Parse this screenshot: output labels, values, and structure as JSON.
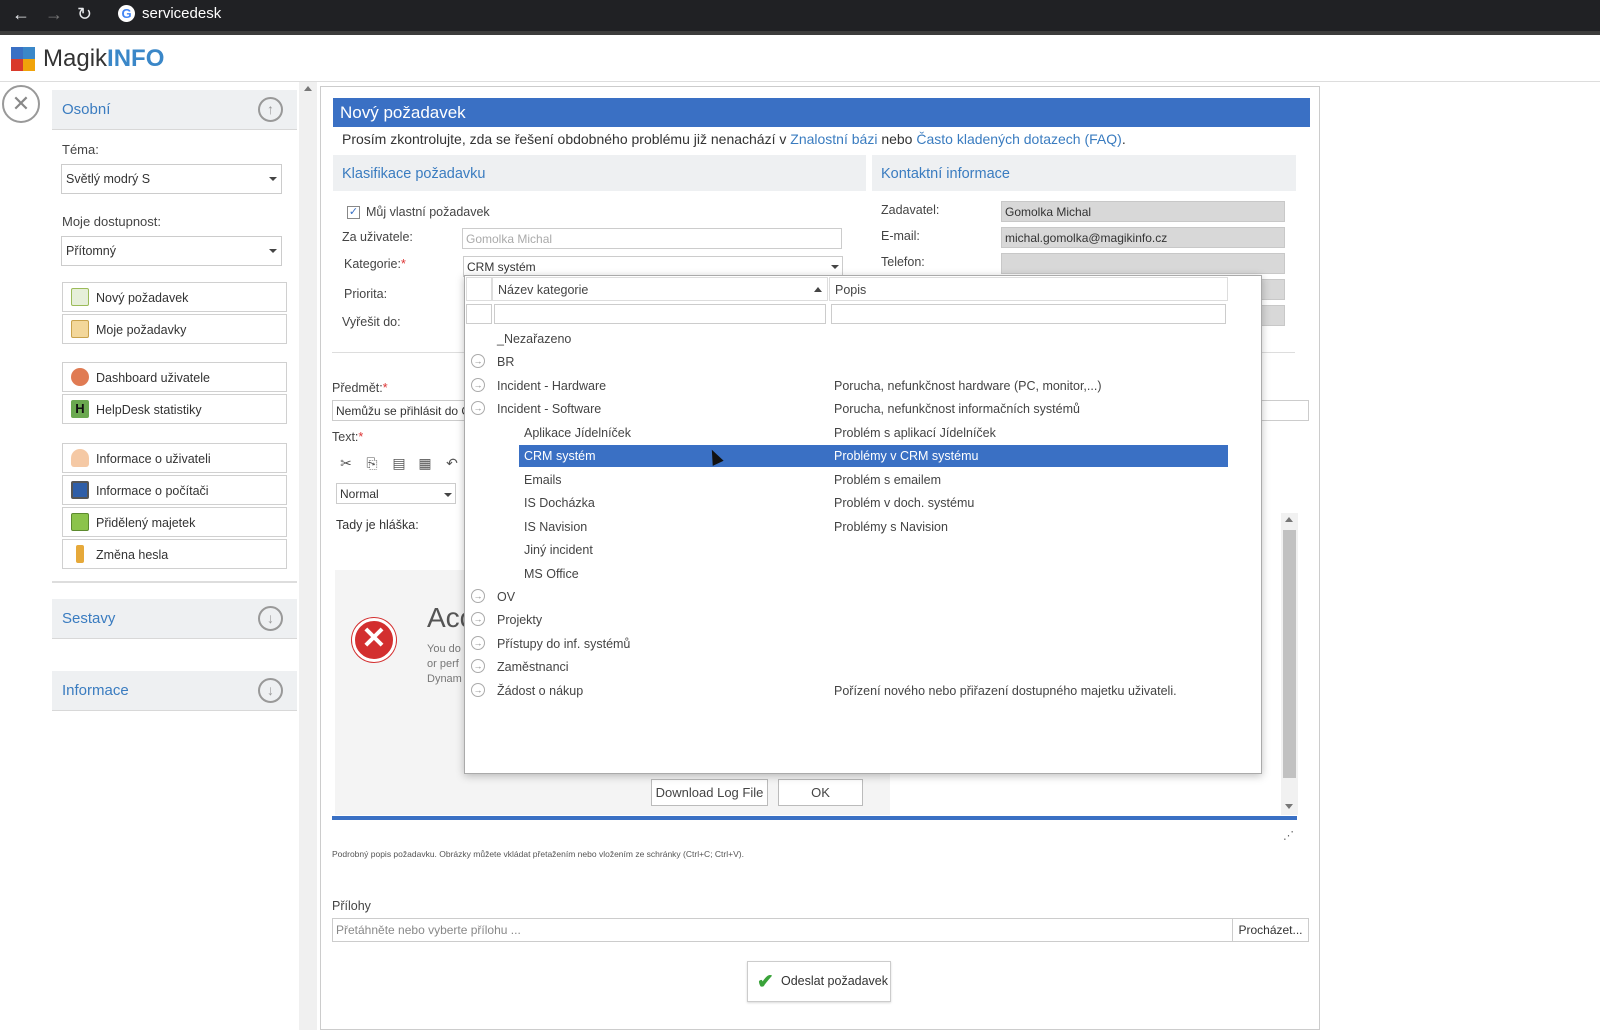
{
  "browser": {
    "url": "servicedesk"
  },
  "logo": {
    "part1": "Magik",
    "part2": "INFO"
  },
  "sidebar": {
    "section_personal": "Osobní",
    "theme_label": "Téma:",
    "theme_value": "Světlý modrý S",
    "availability_label": "Moje dostupnost:",
    "availability_value": "Přítomný",
    "buttons": [
      {
        "label": "Nový požadavek"
      },
      {
        "label": "Moje požadavky"
      },
      {
        "label": "Dashboard uživatele"
      },
      {
        "label": "HelpDesk statistiky"
      },
      {
        "label": "Informace o uživateli"
      },
      {
        "label": "Informace o počítači"
      },
      {
        "label": "Přidělený majetek"
      },
      {
        "label": "Změna hesla"
      }
    ],
    "section_reports": "Sestavy",
    "section_info": "Informace"
  },
  "form": {
    "title": "Nový požadavek",
    "notice_pre": "Prosím zkontrolujte, zda se řešení obdobného problému již nenachází v ",
    "notice_link1": "Znalostní bázi",
    "notice_mid": " nebo ",
    "notice_link2": "Často kladených dotazech (FAQ)",
    "notice_end": ".",
    "classification_header": "Klasifikace požadavku",
    "contact_header": "Kontaktní informace",
    "own_request_label": "Můj vlastní požadavek",
    "for_user_label": "Za uživatele:",
    "for_user_value": "Gomolka Michal",
    "category_label": "Kategorie:",
    "category_value": "CRM systém",
    "priority_label": "Priorita:",
    "resolve_by_label": "Vyřešit do:",
    "requester_label": "Zadavatel:",
    "requester_value": "Gomolka Michal",
    "email_label": "E-mail:",
    "email_value": "michal.gomolka@magikinfo.cz",
    "phone_label": "Telefon:",
    "phone_value": "",
    "subject_label": "Předmět:",
    "subject_value": "Nemůžu se přihlásit do C",
    "text_label": "Text:",
    "format_value": "Normal",
    "editor_text": "Tady je hláška:",
    "error_title": "Acc",
    "error_lines": [
      "You do",
      "or perf",
      "Dynam"
    ],
    "error_download_btn": "Download Log File",
    "error_ok_btn": "OK",
    "hint": "Podrobný popis požadavku. Obrázky můžete vkládat přetažením nebo vložením ze schránky (Ctrl+C; Ctrl+V).",
    "attachments_label": "Přílohy",
    "attachments_placeholder": "Přetáhněte nebo vyberte přílohu ...",
    "browse_btn": "Procházet...",
    "submit_btn": "Odeslat požadavek"
  },
  "dropdown": {
    "col_name": "Název kategorie",
    "col_desc": "Popis",
    "rows": [
      {
        "name": "_Nezařazeno",
        "desc": "",
        "level": 0,
        "expand": false
      },
      {
        "name": "BR",
        "desc": "",
        "level": 0,
        "expand": true
      },
      {
        "name": "Incident - Hardware",
        "desc": "Porucha, nefunkčnost hardware (PC, monitor,...)",
        "level": 0,
        "expand": true
      },
      {
        "name": "Incident - Software",
        "desc": "Porucha, nefunkčnost informačních systémů",
        "level": 0,
        "expand": true
      },
      {
        "name": "Aplikace Jídelníček",
        "desc": "Problém s aplikací Jídelníček",
        "level": 1,
        "expand": false
      },
      {
        "name": "CRM systém",
        "desc": "Problémy v CRM systému",
        "level": 1,
        "expand": false,
        "selected": true
      },
      {
        "name": "Emails",
        "desc": "Problém s emailem",
        "level": 1,
        "expand": false
      },
      {
        "name": "IS Docházka",
        "desc": "Problém v doch. systému",
        "level": 1,
        "expand": false
      },
      {
        "name": "IS Navision",
        "desc": "Problémy s Navision",
        "level": 1,
        "expand": false
      },
      {
        "name": "Jiný incident",
        "desc": "",
        "level": 1,
        "expand": false
      },
      {
        "name": "MS Office",
        "desc": "",
        "level": 1,
        "expand": false
      },
      {
        "name": "OV",
        "desc": "",
        "level": 0,
        "expand": true
      },
      {
        "name": "Projekty",
        "desc": "",
        "level": 0,
        "expand": true
      },
      {
        "name": "Přístupy do inf. systémů",
        "desc": "",
        "level": 0,
        "expand": true
      },
      {
        "name": "Zaměstnanci",
        "desc": "",
        "level": 0,
        "expand": true
      },
      {
        "name": "Žádost o nákup",
        "desc": "Pořízení nového nebo přiřazení dostupného majetku uživateli.",
        "level": 0,
        "expand": true
      }
    ]
  },
  "colors": {
    "accent": "#3a70c4",
    "link": "#3a7cc0"
  }
}
